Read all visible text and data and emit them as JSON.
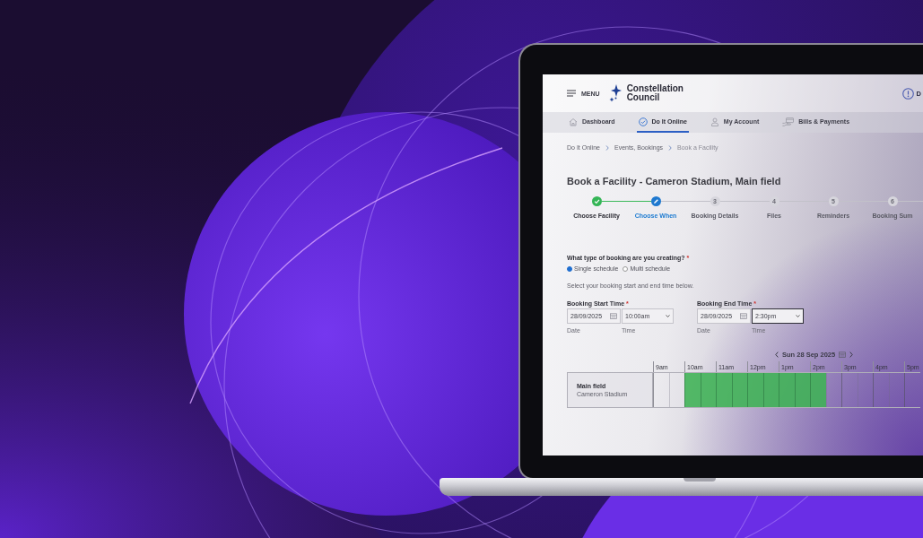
{
  "header": {
    "menu_label": "MENU",
    "logo_text": "Constellation Council",
    "right_text": "D"
  },
  "nav": [
    {
      "label": "Dashboard",
      "selected": false
    },
    {
      "label": "Do It Online",
      "selected": true
    },
    {
      "label": "My Account",
      "selected": false
    },
    {
      "label": "Bills & Payments",
      "selected": false
    }
  ],
  "breadcrumb": [
    {
      "label": "Do It Online",
      "current": false
    },
    {
      "label": "Events, Bookings",
      "current": false
    },
    {
      "label": "Book a Facility",
      "current": true
    }
  ],
  "title": "Book a Facility - Cameron Stadium, Main field",
  "steps": [
    {
      "label": "Choose Facility",
      "completed": true,
      "selected": false
    },
    {
      "label": "Choose When",
      "completed": false,
      "selected": true
    },
    {
      "label": "Booking Details",
      "number": "3",
      "completed": false,
      "selected": false
    },
    {
      "label": "Files",
      "number": "4",
      "completed": false,
      "selected": false
    },
    {
      "label": "Reminders",
      "number": "5",
      "completed": false,
      "selected": false
    },
    {
      "label": "Booking Sum",
      "number": "6",
      "completed": false,
      "selected": false
    }
  ],
  "booking_type": {
    "question": "What type of booking are you creating?",
    "required_mark": "*",
    "options": [
      {
        "label": "Single schedule",
        "selected": true
      },
      {
        "label": "Multi schedule",
        "selected": false
      }
    ]
  },
  "instruction": "Select your booking start and end time below.",
  "times": [
    {
      "label": "Booking Start Time",
      "required_mark": "*",
      "date": {
        "value": "28/09/2025",
        "caption": "Date"
      },
      "time": {
        "value": "10:00am",
        "caption": "Time",
        "focused": false
      }
    },
    {
      "label": "Booking End Time",
      "required_mark": "*",
      "date": {
        "value": "28/09/2025",
        "caption": "Date"
      },
      "time": {
        "value": "2:30pm",
        "caption": "Time",
        "focused": true
      }
    }
  ],
  "schedule": {
    "date_label": "Sun 28 Sep 2025",
    "hours": [
      "9am",
      "10am",
      "11am",
      "12pm",
      "1pm",
      "2pm",
      "3pm",
      "4pm",
      "5pm"
    ],
    "resource": {
      "name": "Main field",
      "location": "Cameron Stadium"
    },
    "slots": [
      {
        "selected": false
      },
      {
        "selected": false
      },
      {
        "selected": true
      },
      {
        "selected": true
      },
      {
        "selected": true
      },
      {
        "selected": true
      },
      {
        "selected": true
      },
      {
        "selected": true
      },
      {
        "selected": true
      },
      {
        "selected": true
      },
      {
        "selected": true
      },
      {
        "selected": false
      },
      {
        "selected": false
      },
      {
        "selected": false
      },
      {
        "selected": false
      },
      {
        "selected": false
      },
      {
        "selected": false
      }
    ]
  }
}
